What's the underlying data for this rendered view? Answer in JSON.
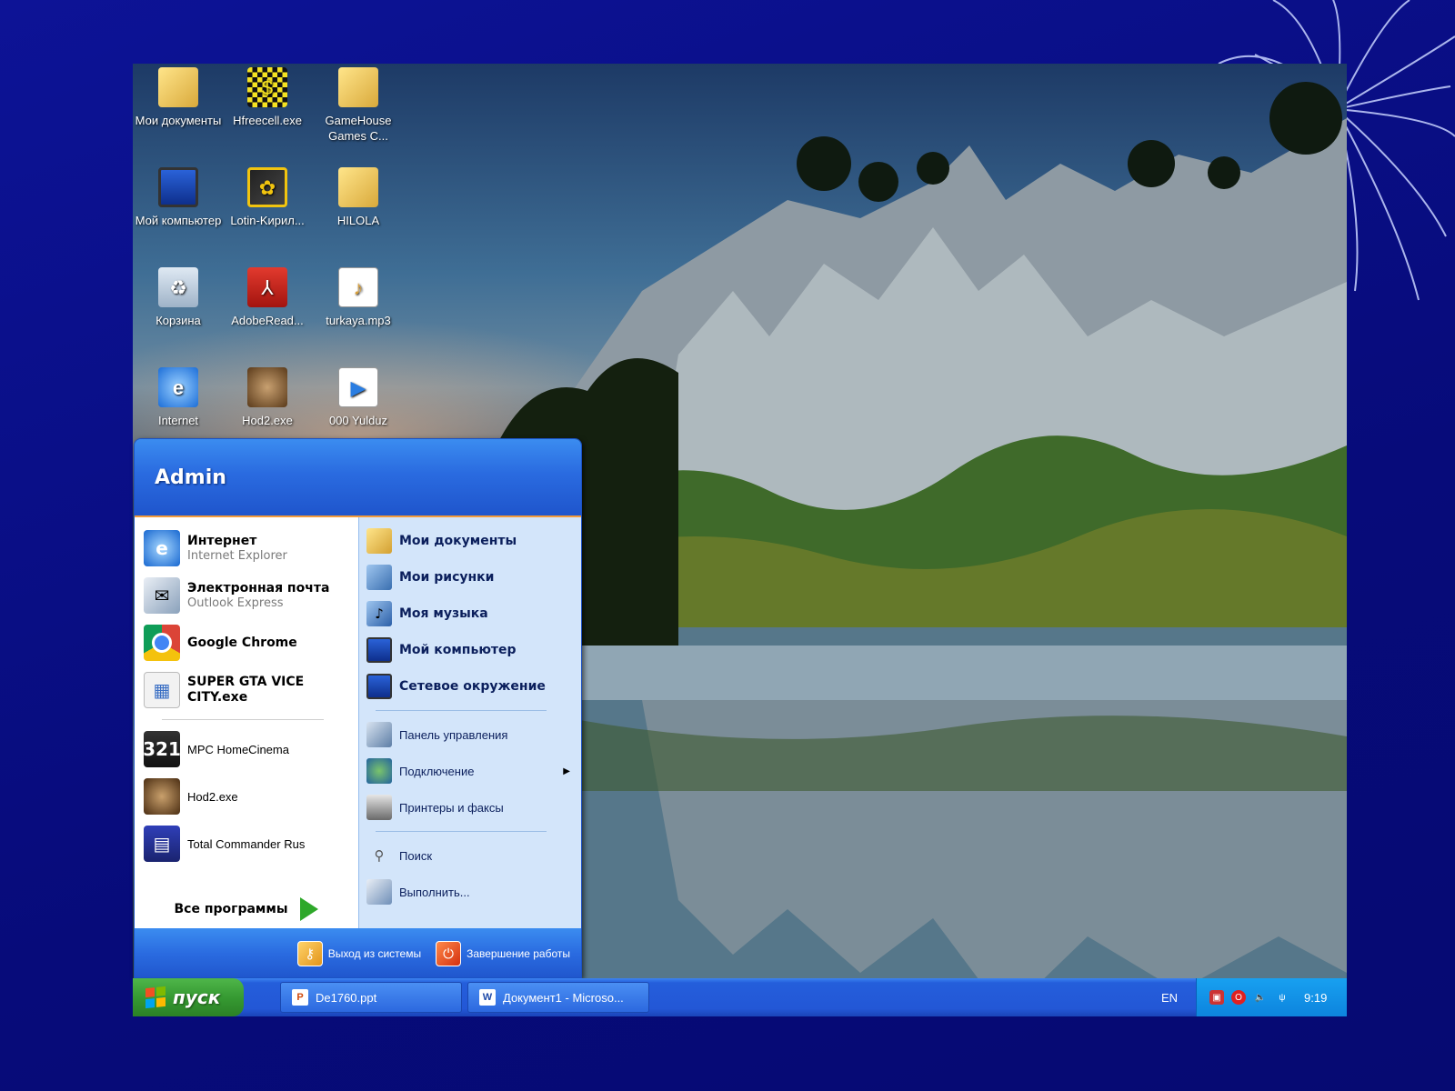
{
  "desktop": {
    "icons": [
      {
        "label": "Мои документы",
        "icon": "folder-icon"
      },
      {
        "label": "Hfreecell.exe",
        "icon": "checker-icon"
      },
      {
        "label": "GameHouse Games C...",
        "icon": "folder-icon"
      },
      {
        "label": "Мой компьютер",
        "icon": "monitor-icon"
      },
      {
        "label": "Lotin-Kирил...",
        "icon": "app-icon"
      },
      {
        "label": "HILOLA",
        "icon": "folder-icon"
      },
      {
        "label": "Корзина",
        "icon": "recycle-bin-icon"
      },
      {
        "label": "AdobeRead...",
        "icon": "adobe-icon"
      },
      {
        "label": "turkaya.mp3",
        "icon": "audio-file-icon"
      },
      {
        "label": "Internet",
        "icon": "ie-icon"
      },
      {
        "label": "Hod2.exe",
        "icon": "face-icon"
      },
      {
        "label": "000 Yulduz",
        "icon": "media-file-icon"
      }
    ]
  },
  "start_menu": {
    "user": "Admin",
    "pinned": [
      {
        "title": "Интернет",
        "subtitle": "Internet Explorer"
      },
      {
        "title": "Электронная почта",
        "subtitle": "Outlook Express"
      }
    ],
    "recent": [
      "Google Chrome",
      "SUPER GTA VICE CITY.exe",
      "MPC HomeCinema",
      "Hod2.exe",
      "Total Commander Rus"
    ],
    "all_programs": "Все программы",
    "places": [
      "Мои документы",
      "Мои рисунки",
      "Моя музыка",
      "Мой компьютер",
      "Сетевое окружение"
    ],
    "system": [
      "Панель управления",
      "Подключение",
      "Принтеры и факсы"
    ],
    "tools": [
      "Поиск",
      "Выполнить..."
    ],
    "logoff": "Выход из системы",
    "shutdown": "Завершение работы"
  },
  "taskbar": {
    "start_label": "пуск",
    "tasks": [
      "De1760.ppt",
      "Документ1 - Microso..."
    ],
    "language": "EN",
    "clock": "9:19"
  }
}
